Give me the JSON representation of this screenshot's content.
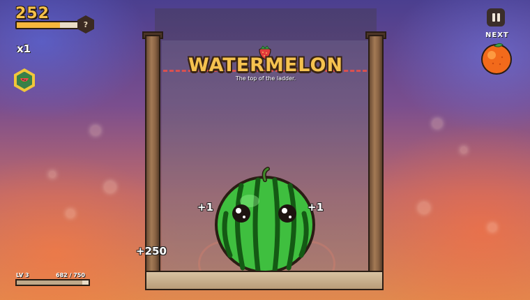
{
  "hud": {
    "score": "252",
    "score_progress": 0.7,
    "help_label": "?",
    "multiplier": "x1",
    "level": "LV 3",
    "xp": "682 / 750",
    "xp_progress": 0.909
  },
  "next": {
    "label": "NEXT",
    "fruit_icon": "orange-icon"
  },
  "merge_banner": {
    "title": "WATERMELON",
    "subtitle": "The top of the ladder."
  },
  "popups": [
    "+1",
    "+1",
    "+250"
  ],
  "colors": {
    "score": "#f6c14a",
    "title": "#f5c24f",
    "danger_line": "#d95050",
    "melon_green": "#3fbf3f"
  }
}
